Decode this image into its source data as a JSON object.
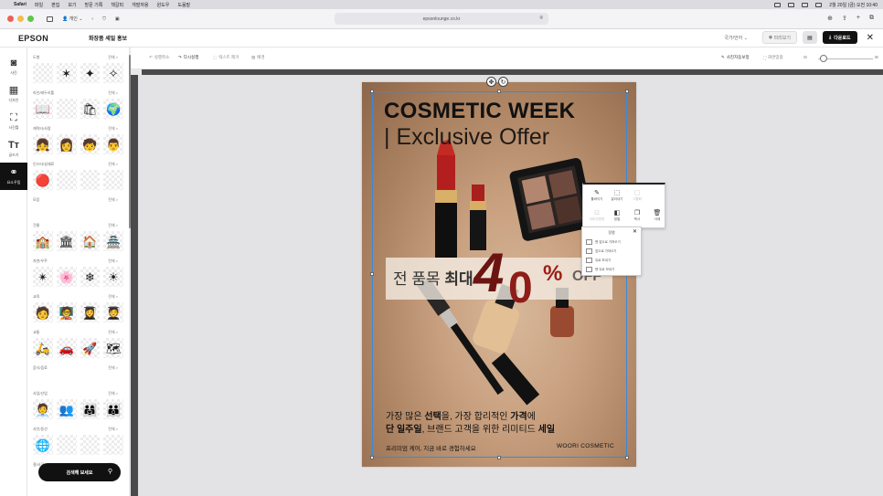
{
  "system_menubar": {
    "apple": "",
    "app": "Safari",
    "items": [
      "파일",
      "편집",
      "보기",
      "방문 기록",
      "책갈피",
      "개발자용",
      "윈도우",
      "도움말"
    ],
    "clock": "2월 20일 (금) 오전 10:40"
  },
  "browser": {
    "url": "epsonlounge.co.kr",
    "profile": "개인"
  },
  "app": {
    "logo": "EPSON",
    "doc_title": "화장품 세일 홍보",
    "language": "국가/언어",
    "preview": "미리보기",
    "download": "다운로드"
  },
  "rail": [
    {
      "icon": "camera-icon",
      "glyph": "📷",
      "label": "사진"
    },
    {
      "icon": "grid-icon",
      "glyph": "▦",
      "label": "디자인"
    },
    {
      "icon": "frame-icon",
      "glyph": "⧉",
      "label": "사진틀"
    },
    {
      "icon": "text-icon",
      "glyph": "Tт",
      "label": "글쓰기"
    },
    {
      "icon": "elements-icon",
      "glyph": "⚭",
      "label": "요소꾸밈"
    }
  ],
  "panel": {
    "all_label": "전체 >",
    "sections": [
      {
        "title": "도형",
        "items": [
          "",
          "✶",
          "✦",
          "✧"
        ]
      },
      {
        "title": "라인/테두리틀",
        "items": [
          "📖",
          "",
          "🛍",
          "🌍"
        ]
      },
      {
        "title": "캐릭터/사람",
        "items": [
          "👧",
          "👩",
          "🧒",
          "👨"
        ]
      },
      {
        "title": "인스타/실재료",
        "items": [
          "🔴",
          "",
          "",
          ""
        ]
      },
      {
        "title": "모음",
        "items": []
      },
      {
        "title": "건물",
        "items": [
          "🏫",
          "🏛",
          "🏠",
          "🏯"
        ]
      },
      {
        "title": "자연/우주",
        "items": [
          "✴",
          "🌸",
          "❄",
          "☀"
        ]
      },
      {
        "title": "교육",
        "items": [
          "🧑",
          "🧑‍🏫",
          "👩‍🎓",
          "🧑‍🎓"
        ]
      },
      {
        "title": "교통",
        "items": [
          "🛵",
          "🚗",
          "🚀",
          "🗺"
        ]
      },
      {
        "title": "음식/음료",
        "items": []
      },
      {
        "title": "사업/산업",
        "items": [
          "🧑‍💼",
          "👥",
          "👨‍👩‍👧",
          "👪"
        ]
      },
      {
        "title": "사인/동선",
        "items": [
          "🌐",
          "",
          "",
          ""
        ]
      },
      {
        "title": "절/사무",
        "items": []
      }
    ]
  },
  "search": {
    "label": "검색해 보세요"
  },
  "toolbar": {
    "undo": "실행취소",
    "redo": "다시실행",
    "text_remove": "텍스트 제거",
    "bg": "배경",
    "ai_photo": "사진자동보정",
    "fullscreen": "화면맞춤"
  },
  "poster": {
    "headline": "COSMETIC WEEK",
    "subhead": "| Exclusive Offer",
    "band_prefix": "전 품목 ",
    "band_bold": "최대",
    "big4": "4",
    "big0": "0",
    "percent": "%",
    "off": "OFF",
    "body1a": "가장 많은 ",
    "body1b": "선택",
    "body1c": "을, 가장 합리적인 ",
    "body1d": "가격",
    "body1e": "에",
    "body2a": "단 일주일",
    "body2b": ", 브랜드 고객을 위한 리미티드 ",
    "body2c": "세일",
    "footer_left": "프리미엄 케어, 지금 바로 경험하세요",
    "footer_right": "WOORI COSMETIC"
  },
  "context_menu": {
    "items": [
      {
        "label": "툴바이기",
        "icon": "brush-icon",
        "dim": false
      },
      {
        "label": "잘라내기",
        "icon": "crop-icon",
        "dim": false
      },
      {
        "label": "그룹화",
        "icon": "group-icon",
        "dim": true
      },
      {
        "label": "이미지변경",
        "icon": "image-icon",
        "dim": true
      },
      {
        "label": "정렬",
        "icon": "layer-icon",
        "dim": false
      },
      {
        "label": "복사",
        "icon": "copy-icon",
        "dim": false
      },
      {
        "label": "삭제",
        "icon": "trash-icon",
        "dim": false
      }
    ]
  },
  "submenu": {
    "title": "정렬",
    "items": [
      "맨 앞으로 가져오기",
      "앞으로 가져오기",
      "뒤로 보내기",
      "맨 뒤로 보내기"
    ]
  }
}
